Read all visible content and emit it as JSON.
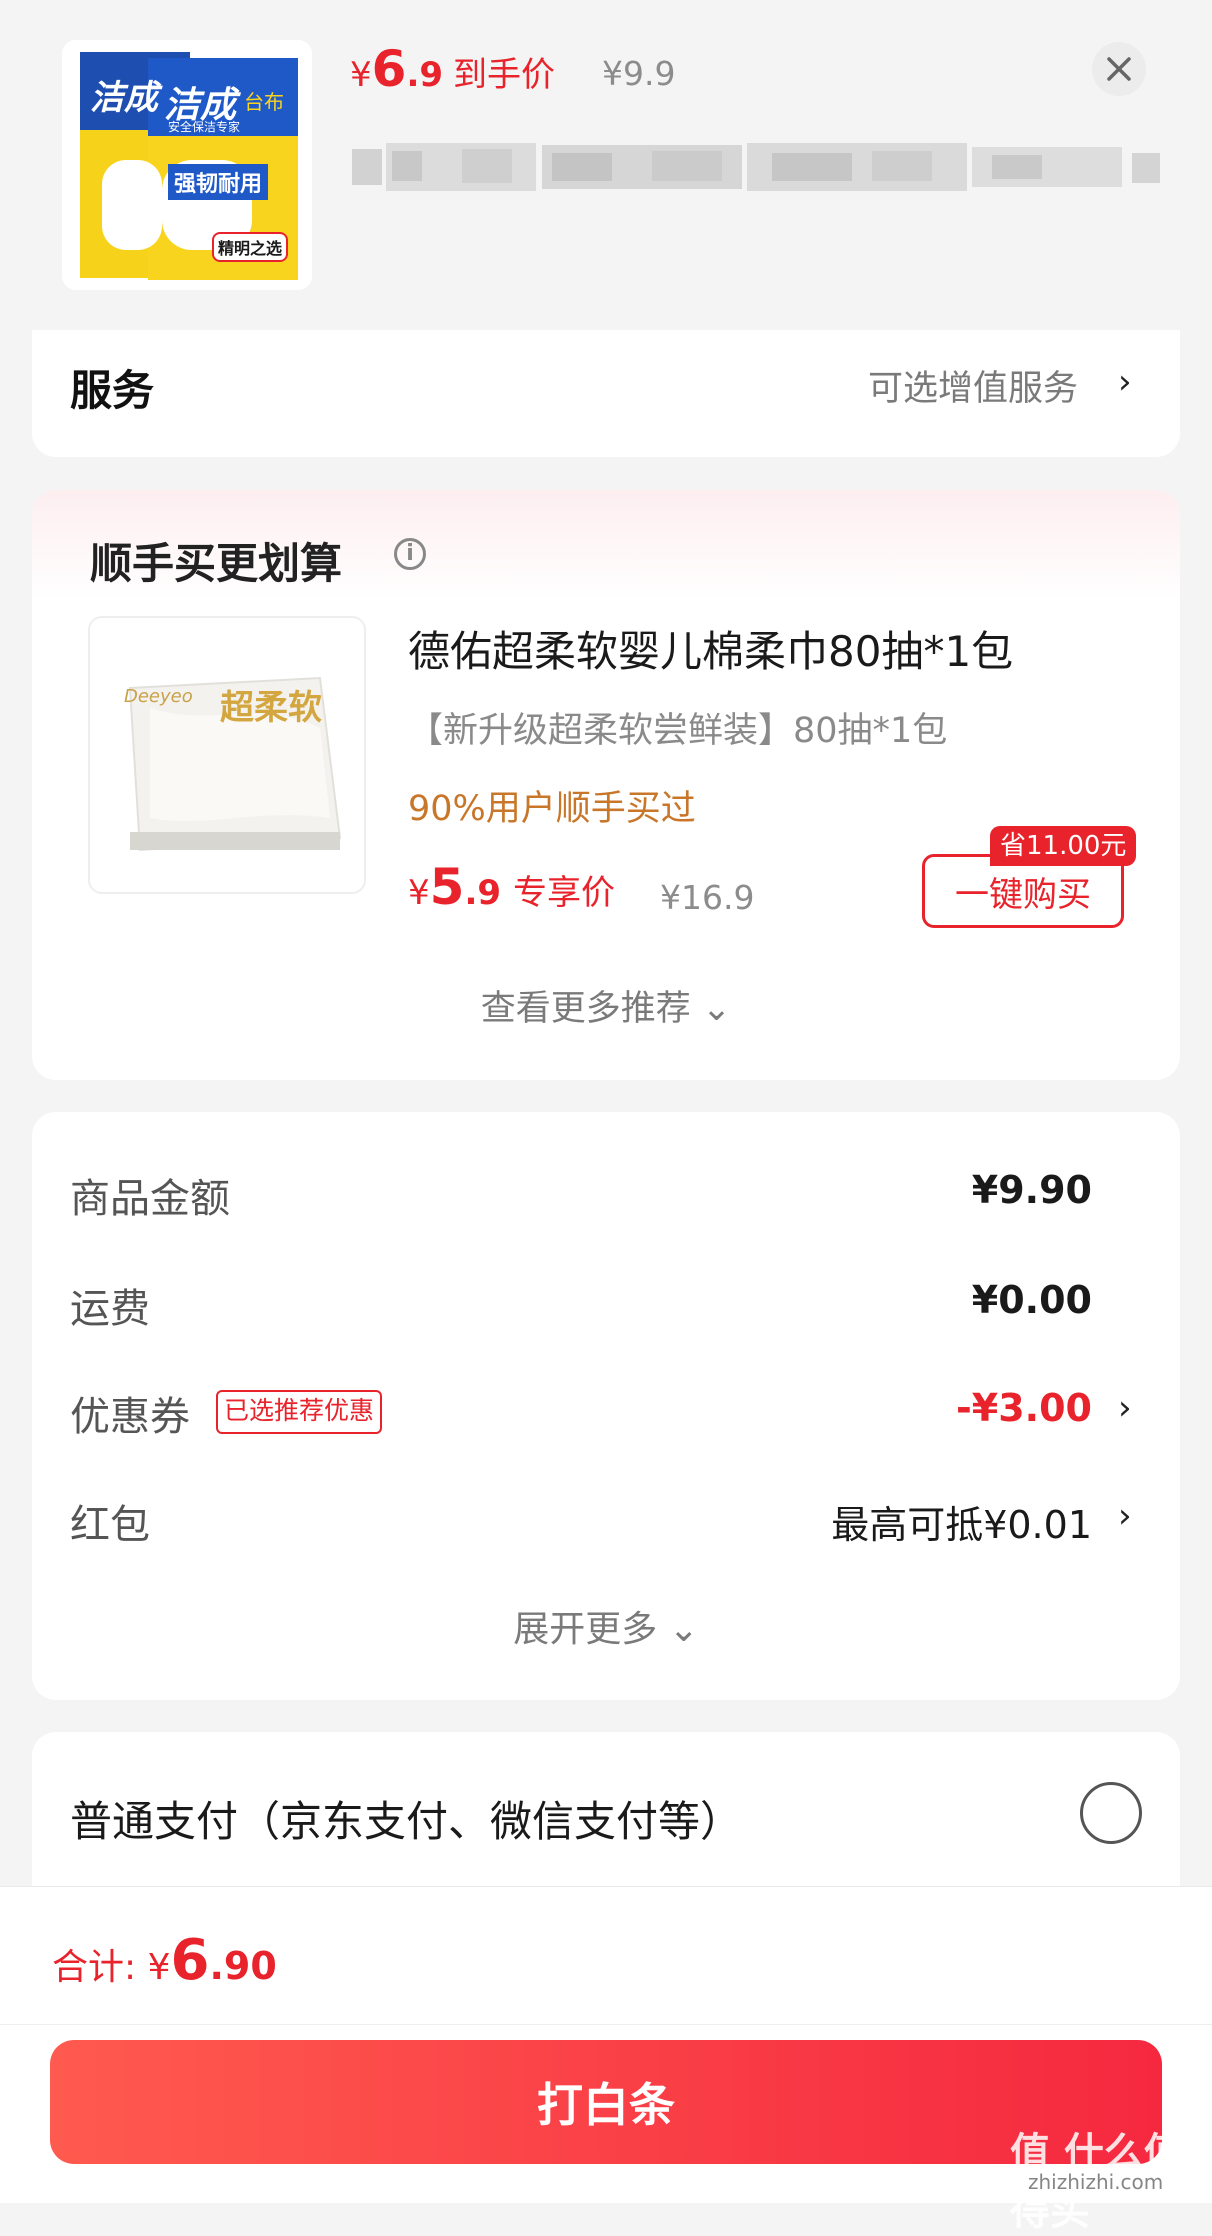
{
  "header": {
    "price_symbol": "¥",
    "price_int": "6",
    "price_dec": ".9",
    "price_label": "到手价",
    "old_price": "¥9.9",
    "product_image_brand": "洁成",
    "product_image_subbrand": "台布",
    "product_image_tagline": "安全保洁专家",
    "product_image_feature": "强韧耐用",
    "product_image_badge": "精明之选"
  },
  "service": {
    "title": "服务",
    "right_text": "可选增值服务",
    "arrow": "›"
  },
  "recommend": {
    "title": "顺手买更划算",
    "info_icon": "i",
    "item": {
      "name": "德佑超柔软婴儿棉柔巾80抽*1包",
      "spec": "【新升级超柔软尝鲜装】80抽*1包",
      "sold": "90%用户顺手买过",
      "price_symbol": "¥",
      "price_int": "5",
      "price_dec": ".9",
      "price_label": "专享价",
      "old_price": "¥16.9",
      "save_tag": "省11.00元",
      "buy_label": "一键购买",
      "image_brand": "Deeyeo",
      "image_text": "超柔软"
    },
    "more": "查看更多推荐 ⌄"
  },
  "amounts": {
    "goods_label": "商品金额",
    "goods_value": "¥9.90",
    "shipping_label": "运费",
    "shipping_value": "¥0.00",
    "coupon_label": "优惠券",
    "coupon_tag": "已选推荐优惠",
    "coupon_value": "-¥3.00",
    "redpacket_label": "红包",
    "redpacket_value": "最高可抵¥0.01",
    "arrow": "›",
    "expand": "展开更多 ⌄"
  },
  "payment": {
    "normal_label": "普通支付（京东支付、微信支付等）"
  },
  "footer": {
    "total_label": "合计: ",
    "total_symbol": "¥",
    "total_int": "6",
    "total_dec": ".90",
    "pay_button": "打白条",
    "watermark": "值 什么值得买",
    "watermark_url": "zhizhizhi.com"
  },
  "colors": {
    "accent": "#e8232b",
    "sold_text": "#c8772a",
    "background": "#f4f4f4"
  }
}
